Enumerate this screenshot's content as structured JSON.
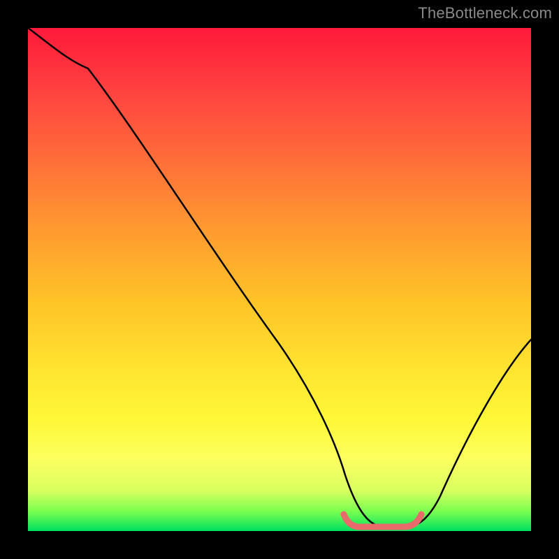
{
  "watermark": "TheBottleneck.com",
  "chart_data": {
    "type": "line",
    "title": "",
    "xlabel": "",
    "ylabel": "",
    "xlim": [
      0,
      100
    ],
    "ylim": [
      0,
      100
    ],
    "series": [
      {
        "name": "bottleneck-curve",
        "x": [
          0,
          6,
          12,
          20,
          30,
          40,
          50,
          58,
          63,
          68,
          73,
          76,
          80,
          90,
          100
        ],
        "values": [
          100,
          97,
          92,
          82,
          67,
          52,
          37,
          23,
          12,
          4,
          1,
          1,
          4,
          18,
          38
        ]
      }
    ],
    "annotations": [
      {
        "name": "optimal-range-marker",
        "x_start": 63,
        "x_end": 76,
        "y": 1
      }
    ],
    "background_gradient": {
      "orientation": "vertical",
      "stops": [
        {
          "pos": 0.0,
          "color": "#ff1a3c"
        },
        {
          "pos": 0.25,
          "color": "#ff6a3a"
        },
        {
          "pos": 0.55,
          "color": "#ffc528"
        },
        {
          "pos": 0.78,
          "color": "#fff838"
        },
        {
          "pos": 0.96,
          "color": "#7cff50"
        },
        {
          "pos": 1.0,
          "color": "#00e060"
        }
      ]
    },
    "colors": {
      "curve": "#000000",
      "marker": "#e86a6a",
      "frame": "#000000"
    }
  }
}
